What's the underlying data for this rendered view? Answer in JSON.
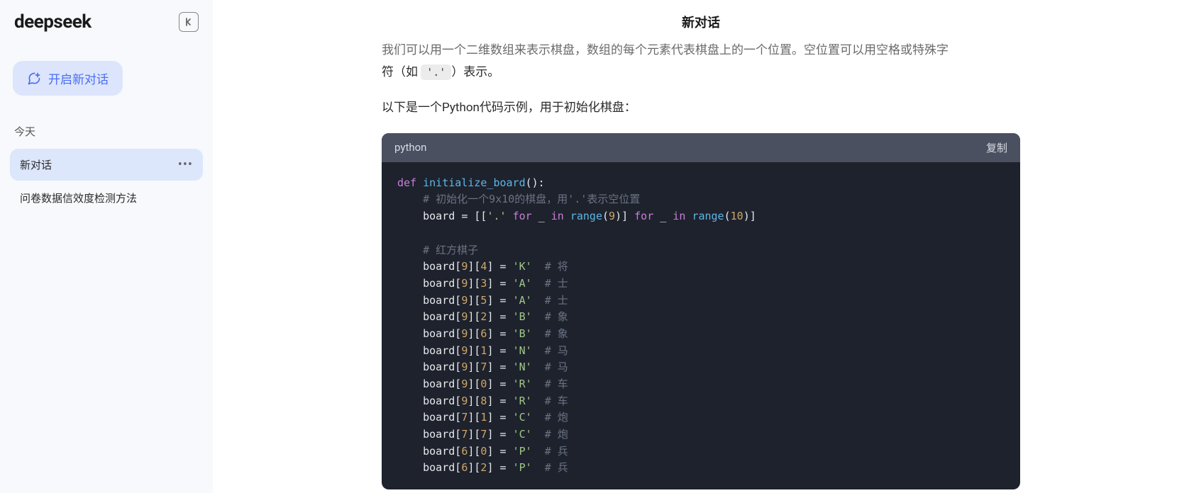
{
  "brand": "deepseek",
  "sidebar": {
    "new_chat_label": "开启新对话",
    "section_today": "今天",
    "items": [
      {
        "label": "新对话",
        "active": true
      },
      {
        "label": "问卷数据信效度检测方法",
        "active": false
      }
    ]
  },
  "header": {
    "title": "新对话"
  },
  "body": {
    "partial_line": "我们可以用一个二维数组来表示棋盘，数组的每个元素代表棋盘上的一个位置。空位置可以用空格或特殊字",
    "line_keyword": "'.'",
    "line_before": "符（如 ",
    "line_after": "）表示。",
    "intro": "以下是一个Python代码示例，用于初始化棋盘："
  },
  "code": {
    "language": "python",
    "copy_label": "复制",
    "lines": [
      {
        "type": "def",
        "tokens": [
          {
            "t": "kw",
            "v": "def"
          },
          {
            "t": "sp"
          },
          {
            "t": "fn",
            "v": "initialize_board"
          },
          {
            "t": "punc",
            "v": "():"
          }
        ]
      },
      {
        "type": "cmt",
        "indent": 1,
        "tokens": [
          {
            "t": "cmt",
            "v": "# 初始化一个9x10的棋盘，用'.'表示空位置"
          }
        ]
      },
      {
        "type": "init",
        "indent": 1,
        "tokens": [
          {
            "t": "var",
            "v": "board"
          },
          {
            "t": "sp"
          },
          {
            "t": "punc",
            "v": "= [["
          },
          {
            "t": "str",
            "v": "'.'"
          },
          {
            "t": "sp"
          },
          {
            "t": "kw",
            "v": "for"
          },
          {
            "t": "sp"
          },
          {
            "t": "punc",
            "v": "_"
          },
          {
            "t": "sp"
          },
          {
            "t": "kw",
            "v": "in"
          },
          {
            "t": "sp"
          },
          {
            "t": "bltn",
            "v": "range"
          },
          {
            "t": "punc",
            "v": "("
          },
          {
            "t": "num",
            "v": "9"
          },
          {
            "t": "punc",
            "v": ")]"
          },
          {
            "t": "sp"
          },
          {
            "t": "kw",
            "v": "for"
          },
          {
            "t": "sp"
          },
          {
            "t": "punc",
            "v": "_"
          },
          {
            "t": "sp"
          },
          {
            "t": "kw",
            "v": "in"
          },
          {
            "t": "sp"
          },
          {
            "t": "bltn",
            "v": "range"
          },
          {
            "t": "punc",
            "v": "("
          },
          {
            "t": "num",
            "v": "10"
          },
          {
            "t": "punc",
            "v": ")]"
          }
        ]
      },
      {
        "type": "blank"
      },
      {
        "type": "cmt",
        "indent": 1,
        "tokens": [
          {
            "t": "cmt",
            "v": "# 红方棋子"
          }
        ]
      },
      {
        "type": "assign",
        "indent": 1,
        "row": 9,
        "col": 4,
        "val": "'K'",
        "cmt": "# 将"
      },
      {
        "type": "assign",
        "indent": 1,
        "row": 9,
        "col": 3,
        "val": "'A'",
        "cmt": "# 士"
      },
      {
        "type": "assign",
        "indent": 1,
        "row": 9,
        "col": 5,
        "val": "'A'",
        "cmt": "# 士"
      },
      {
        "type": "assign",
        "indent": 1,
        "row": 9,
        "col": 2,
        "val": "'B'",
        "cmt": "# 象"
      },
      {
        "type": "assign",
        "indent": 1,
        "row": 9,
        "col": 6,
        "val": "'B'",
        "cmt": "# 象"
      },
      {
        "type": "assign",
        "indent": 1,
        "row": 9,
        "col": 1,
        "val": "'N'",
        "cmt": "# 马"
      },
      {
        "type": "assign",
        "indent": 1,
        "row": 9,
        "col": 7,
        "val": "'N'",
        "cmt": "# 马"
      },
      {
        "type": "assign",
        "indent": 1,
        "row": 9,
        "col": 0,
        "val": "'R'",
        "cmt": "# 车"
      },
      {
        "type": "assign",
        "indent": 1,
        "row": 9,
        "col": 8,
        "val": "'R'",
        "cmt": "# 车"
      },
      {
        "type": "assign",
        "indent": 1,
        "row": 7,
        "col": 1,
        "val": "'C'",
        "cmt": "# 炮"
      },
      {
        "type": "assign",
        "indent": 1,
        "row": 7,
        "col": 7,
        "val": "'C'",
        "cmt": "# 炮"
      },
      {
        "type": "assign",
        "indent": 1,
        "row": 6,
        "col": 0,
        "val": "'P'",
        "cmt": "# 兵"
      },
      {
        "type": "assign",
        "indent": 1,
        "row": 6,
        "col": 2,
        "val": "'P'",
        "cmt": "# 兵"
      }
    ]
  }
}
